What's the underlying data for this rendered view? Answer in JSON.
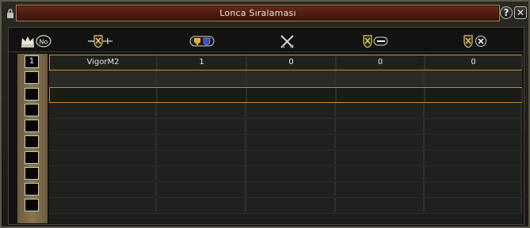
{
  "window": {
    "title": "Lonca Sıralaması"
  },
  "title_buttons": {
    "help": "?",
    "close": "✕"
  },
  "header": {
    "rank_badge": "No",
    "icons": [
      "crown-rank-icon",
      "guild-sword-icon",
      "trophy-points-icon",
      "crossed-swords-icon",
      "win-icon",
      "loss-icon"
    ]
  },
  "rows": [
    {
      "rank": "1",
      "name": "VigorM2",
      "points": "1",
      "c3": "0",
      "c4": "0",
      "c5": "0"
    },
    {
      "rank": "",
      "name": "",
      "points": "",
      "c3": "",
      "c4": "",
      "c5": ""
    },
    {
      "rank": "",
      "name": "",
      "points": "",
      "c3": "",
      "c4": "",
      "c5": ""
    },
    {
      "rank": "",
      "name": "",
      "points": "",
      "c3": "",
      "c4": "",
      "c5": ""
    },
    {
      "rank": "",
      "name": "",
      "points": "",
      "c3": "",
      "c4": "",
      "c5": ""
    },
    {
      "rank": "",
      "name": "",
      "points": "",
      "c3": "",
      "c4": "",
      "c5": ""
    },
    {
      "rank": "",
      "name": "",
      "points": "",
      "c3": "",
      "c4": "",
      "c5": ""
    },
    {
      "rank": "",
      "name": "",
      "points": "",
      "c3": "",
      "c4": "",
      "c5": ""
    },
    {
      "rank": "",
      "name": "",
      "points": "",
      "c3": "",
      "c4": "",
      "c5": ""
    },
    {
      "rank": "",
      "name": "",
      "points": "",
      "c3": "",
      "c4": "",
      "c5": ""
    }
  ],
  "colors": {
    "accent": "#c88a2c",
    "title_bg": "#5a2212",
    "rank_col": "#8b7652"
  }
}
